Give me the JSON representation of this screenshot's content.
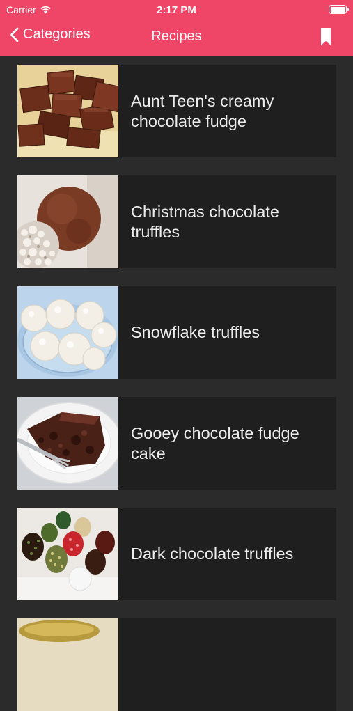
{
  "status_bar": {
    "carrier": "Carrier",
    "time": "2:17 PM",
    "wifi_icon": "wifi-icon",
    "battery_icon": "battery-icon"
  },
  "nav": {
    "back_label": "Categories",
    "title": "Recipes",
    "back_icon": "chevron-left-icon",
    "bookmark_icon": "bookmark-icon"
  },
  "colors": {
    "header": "#ef4566",
    "background": "#2b2b2b",
    "card": "#1f1f20",
    "text": "#ececec"
  },
  "recipes": [
    {
      "title": "Aunt Teen's creamy chocolate fudge",
      "image": "chocolate-fudge-squares-photo"
    },
    {
      "title": "Christmas chocolate truffles",
      "image": "chocolate-truffle-ball-photo"
    },
    {
      "title": "Snowflake truffles",
      "image": "coconut-snowflake-truffles-photo"
    },
    {
      "title": "Gooey chocolate fudge cake",
      "image": "chocolate-cake-slice-photo"
    },
    {
      "title": "Dark chocolate truffles",
      "image": "assorted-dark-truffles-photo"
    },
    {
      "title": "",
      "image": "pastry-photo"
    }
  ]
}
